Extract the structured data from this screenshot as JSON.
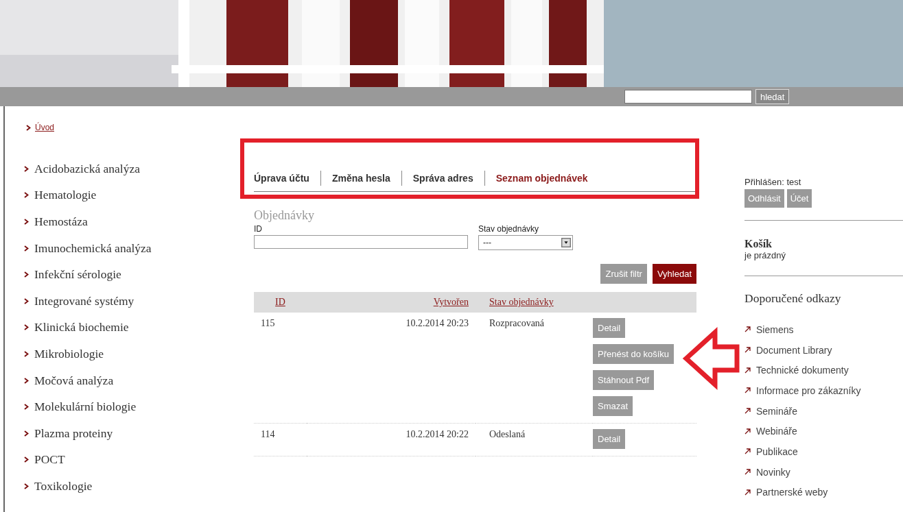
{
  "header": {
    "search": {
      "button": "hledat"
    }
  },
  "breadcrumb": {
    "label": "Úvod"
  },
  "sidebar": {
    "items": [
      {
        "label": "Acidobazická analýza"
      },
      {
        "label": "Hematologie"
      },
      {
        "label": "Hemostáza"
      },
      {
        "label": "Imunochemická analýza"
      },
      {
        "label": "Infekční sérologie"
      },
      {
        "label": "Integrované systémy"
      },
      {
        "label": "Klinická biochemie"
      },
      {
        "label": "Mikrobiologie"
      },
      {
        "label": "Močová analýza"
      },
      {
        "label": "Molekulární biologie"
      },
      {
        "label": "Plazma proteiny"
      },
      {
        "label": "POCT"
      },
      {
        "label": "Toxikologie"
      }
    ]
  },
  "tabs": [
    {
      "label": "Úprava účtu",
      "selected": false
    },
    {
      "label": "Změna hesla",
      "selected": false
    },
    {
      "label": "Správa adres",
      "selected": false
    },
    {
      "label": "Seznam objednávek",
      "selected": true
    }
  ],
  "filter": {
    "title": "Objednávky",
    "id_label": "ID",
    "status_label": "Stav objednávky",
    "status_value": "---",
    "buttons": [
      {
        "label": "Zrušit filtr",
        "kind": "secondary"
      },
      {
        "label": "Vyhledat",
        "kind": "primary"
      }
    ]
  },
  "table": {
    "columns": [
      "ID",
      "Vytvořen",
      "Stav objednávky"
    ],
    "rows": [
      {
        "id": "115",
        "created": "10.2.2014 20:23",
        "status": "Rozpracovaná",
        "actions": [
          "Detail",
          "Přenést do košíku",
          "Stáhnout Pdf",
          "Smazat"
        ]
      },
      {
        "id": "114",
        "created": "10.2.2014 20:22",
        "status": "Odeslaná",
        "actions": [
          "Detail"
        ]
      }
    ]
  },
  "account": {
    "logged_in": "Přihlášen: test",
    "buttons": [
      "Odhlásit",
      "Účet"
    ]
  },
  "cart": {
    "title": "Košík",
    "status": "je prázdný"
  },
  "links": {
    "title": "Doporučené odkazy",
    "items": [
      "Siemens",
      "Document Library",
      "Technické dokumenty",
      "Informace pro zákazníky",
      "Semináře",
      "Webináře",
      "Publikace",
      "Novinky",
      "Partnerské weby"
    ]
  }
}
